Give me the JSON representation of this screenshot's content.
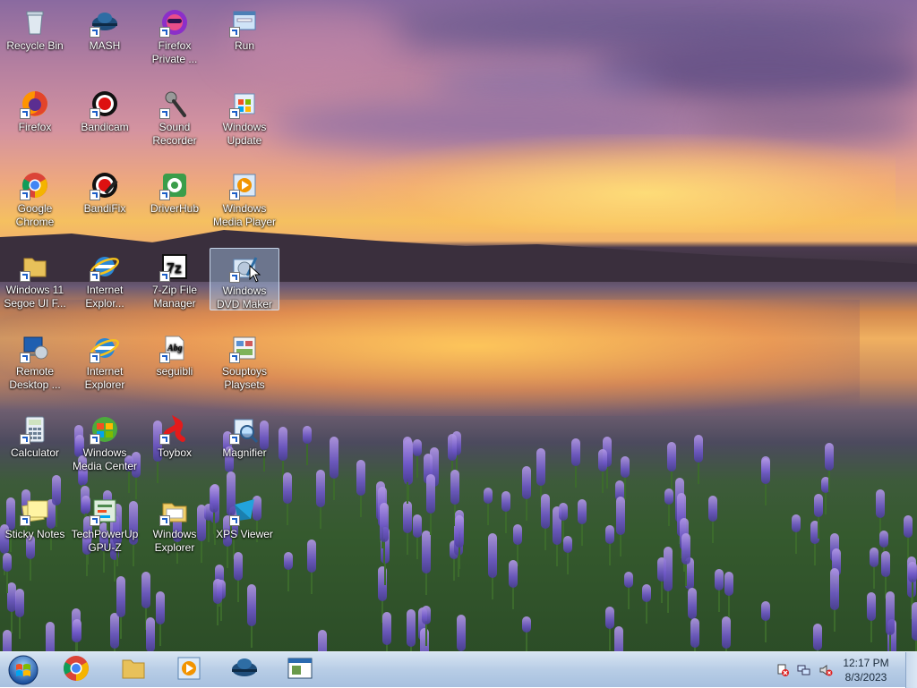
{
  "desktop": {
    "icons": [
      {
        "label": "Recycle Bin",
        "icon": "recycle-bin-icon",
        "selected": false
      },
      {
        "label": "MASH",
        "icon": "mash-icon",
        "selected": false
      },
      {
        "label": "Firefox Private ...",
        "icon": "firefox-private-icon",
        "selected": false
      },
      {
        "label": "Run",
        "icon": "run-icon",
        "selected": false
      },
      {
        "label": "Firefox",
        "icon": "firefox-icon",
        "selected": false
      },
      {
        "label": "Bandicam",
        "icon": "bandicam-icon",
        "selected": false
      },
      {
        "label": "Sound Recorder",
        "icon": "microphone-icon",
        "selected": false
      },
      {
        "label": "Windows Update",
        "icon": "windows-update-icon",
        "selected": false
      },
      {
        "label": "Google Chrome",
        "icon": "chrome-icon",
        "selected": false
      },
      {
        "label": "BandiFix",
        "icon": "bandifix-icon",
        "selected": false
      },
      {
        "label": "DriverHub",
        "icon": "driverhub-icon",
        "selected": false
      },
      {
        "label": "Windows Media Player",
        "icon": "media-player-icon",
        "selected": false
      },
      {
        "label": "Windows 11 Segoe UI F...",
        "icon": "folder-icon",
        "selected": false
      },
      {
        "label": "Internet Explor...",
        "icon": "internet-explorer-icon",
        "selected": false
      },
      {
        "label": "7-Zip File Manager",
        "icon": "7zip-icon",
        "selected": false
      },
      {
        "label": "Windows DVD Maker",
        "icon": "dvd-maker-icon",
        "selected": true
      },
      {
        "label": "Remote Desktop ...",
        "icon": "remote-desktop-icon",
        "selected": false
      },
      {
        "label": "Internet Explorer",
        "icon": "internet-explorer-icon",
        "selected": false
      },
      {
        "label": "seguibli",
        "icon": "font-file-icon",
        "selected": false
      },
      {
        "label": "Souptoys Playsets",
        "icon": "souptoys-icon",
        "selected": false
      },
      {
        "label": "Calculator",
        "icon": "calculator-icon",
        "selected": false
      },
      {
        "label": "Windows Media Center",
        "icon": "media-center-icon",
        "selected": false
      },
      {
        "label": "Toybox",
        "icon": "toybox-icon",
        "selected": false
      },
      {
        "label": "Magnifier",
        "icon": "magnifier-icon",
        "selected": false
      },
      {
        "label": "Sticky Notes",
        "icon": "sticky-notes-icon",
        "selected": false
      },
      {
        "label": "TechPowerUp GPU-Z",
        "icon": "gpu-z-icon",
        "selected": false
      },
      {
        "label": "Windows Explorer",
        "icon": "explorer-folder-icon",
        "selected": false
      },
      {
        "label": "XPS Viewer",
        "icon": "xps-viewer-icon",
        "selected": false
      }
    ]
  },
  "taskbar": {
    "start_icon": "start-orb-icon",
    "pinned": [
      {
        "name": "chrome-taskbar-button",
        "icon": "chrome-icon"
      },
      {
        "name": "explorer-taskbar-button",
        "icon": "folder-icon"
      },
      {
        "name": "media-player-taskbar-button",
        "icon": "media-player-icon"
      },
      {
        "name": "mash-taskbar-button",
        "icon": "mash-icon"
      },
      {
        "name": "window-taskbar-button",
        "icon": "window-icon"
      }
    ],
    "tray": [
      "action-center-icon",
      "network-icon",
      "volume-muted-icon"
    ],
    "clock": {
      "time": "12:17 PM",
      "date": "8/3/2023"
    }
  },
  "colors": {
    "selection": "#aacdf0",
    "taskbar": "#b8cde6",
    "text": "#ffffff"
  }
}
